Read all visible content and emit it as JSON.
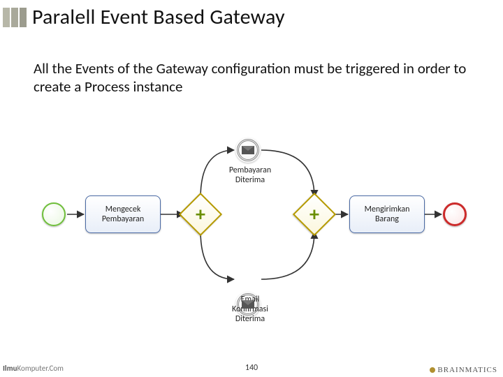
{
  "slide": {
    "title": "Paralell Event Based Gateway",
    "subtitle": "All the Events of the Gateway configuration must be triggered in order to create a Process instance",
    "page_number": "140"
  },
  "footer": {
    "left_brand_prefix": "Ilmu",
    "left_brand_main": "Komputer",
    "left_brand_suffix": ".Com",
    "right_brand": "BRAINMATICS"
  },
  "diagram": {
    "start_event": "start-event",
    "end_event": "end-event",
    "task_check": "Mengecek Pembayaran",
    "task_ship": "Mengirimkan Barang",
    "msg_top_label": "Pembayaran Diterima",
    "msg_bottom_label": "Email Konfirmasi Diterima",
    "gateway_type": "parallel-event-based",
    "icons": {
      "message": "envelope-icon",
      "parallel": "plus-icon"
    }
  }
}
